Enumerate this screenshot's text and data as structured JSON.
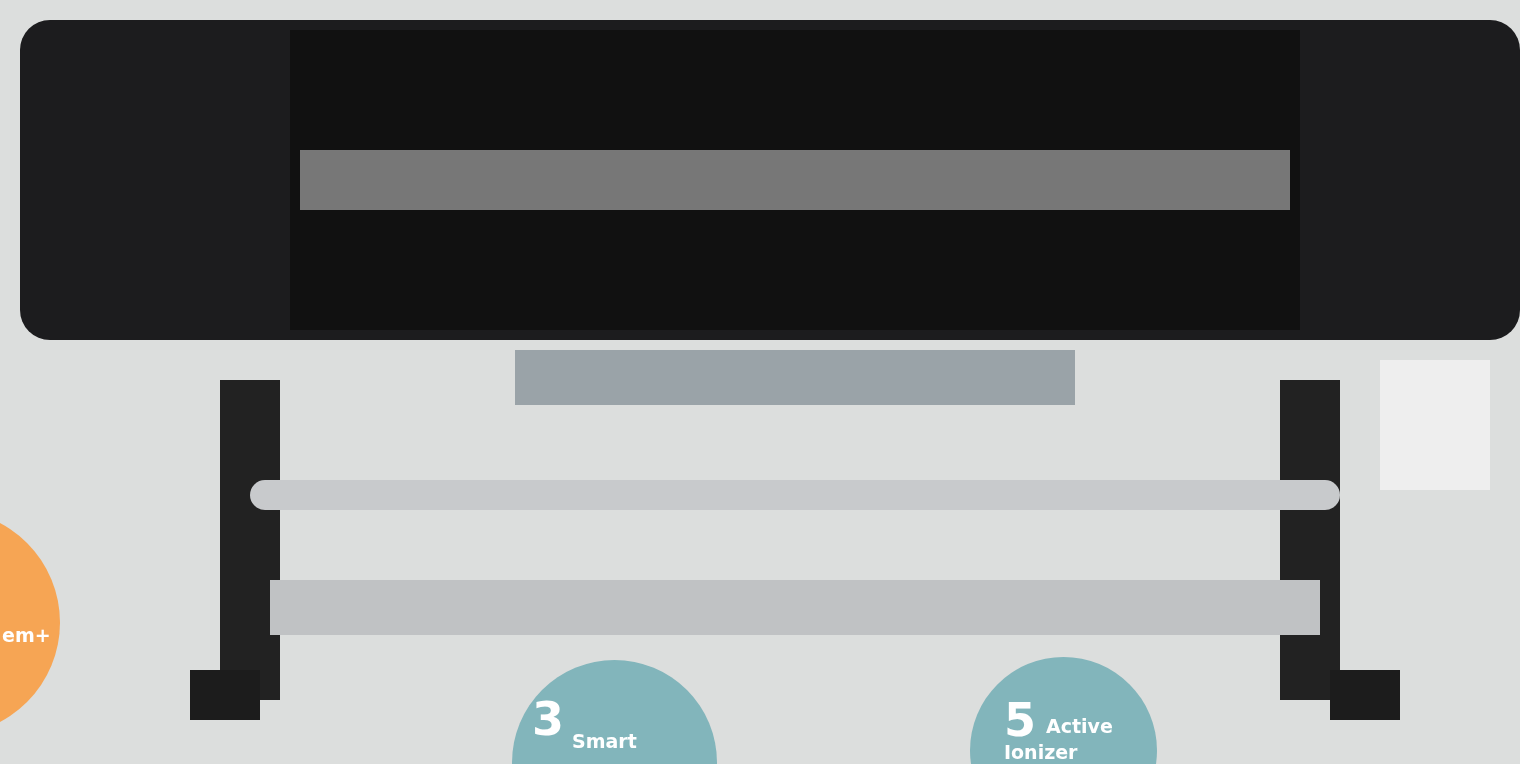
{
  "callouts": [
    {
      "color": "#f6a554",
      "lines": [
        "em+"
      ]
    },
    {
      "number": "3",
      "color": "#82b5bb",
      "lines": [
        "Smart"
      ]
    },
    {
      "number": "5",
      "color": "#82b5bb",
      "lines": [
        "Active",
        "Ionizer"
      ]
    }
  ]
}
